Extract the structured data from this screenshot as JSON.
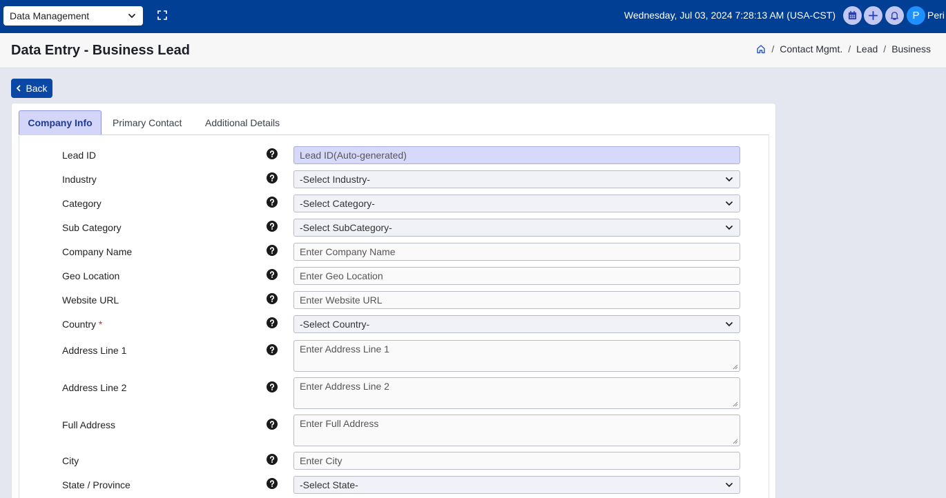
{
  "topbar": {
    "module": "Data Management",
    "datetime": "Wednesday, Jul 03, 2024 7:28:13 AM (USA-CST)",
    "avatar_initial": "P",
    "username": "Peri"
  },
  "header": {
    "title": "Data Entry - Business Lead",
    "breadcrumb": [
      "Contact Mgmt.",
      "Lead",
      "Business"
    ]
  },
  "back_label": "Back",
  "tabs": [
    "Company Info",
    "Primary Contact",
    "Additional Details"
  ],
  "form": {
    "rows": [
      {
        "label": "Lead ID",
        "type": "readonly",
        "text": "Lead ID(Auto-generated)"
      },
      {
        "label": "Industry",
        "type": "select",
        "text": "-Select Industry-"
      },
      {
        "label": "Category",
        "type": "select",
        "text": "-Select Category-"
      },
      {
        "label": "Sub Category",
        "type": "select",
        "text": "-Select SubCategory-"
      },
      {
        "label": "Company Name",
        "type": "input",
        "text": "Enter Company Name"
      },
      {
        "label": "Geo Location",
        "type": "input",
        "text": "Enter Geo Location"
      },
      {
        "label": "Website URL",
        "type": "input",
        "text": "Enter Website URL"
      },
      {
        "label": "Country",
        "required_mark": "*",
        "type": "select",
        "text": "-Select Country-"
      },
      {
        "label": "Address Line 1",
        "type": "textarea",
        "text": "Enter Address Line 1"
      },
      {
        "label": "Address Line 2",
        "type": "textarea",
        "text": "Enter Address Line 2"
      },
      {
        "label": "Full Address",
        "type": "textarea",
        "text": "Enter Full Address"
      },
      {
        "label": "City",
        "type": "input",
        "text": "Enter City"
      },
      {
        "label": "State / Province",
        "type": "select",
        "text": "-Select State-"
      }
    ]
  },
  "colors": {
    "topbar": "#003f93",
    "accent": "#0b48a5",
    "active_tab": "#d3d6f8",
    "required": "#e0232f"
  }
}
